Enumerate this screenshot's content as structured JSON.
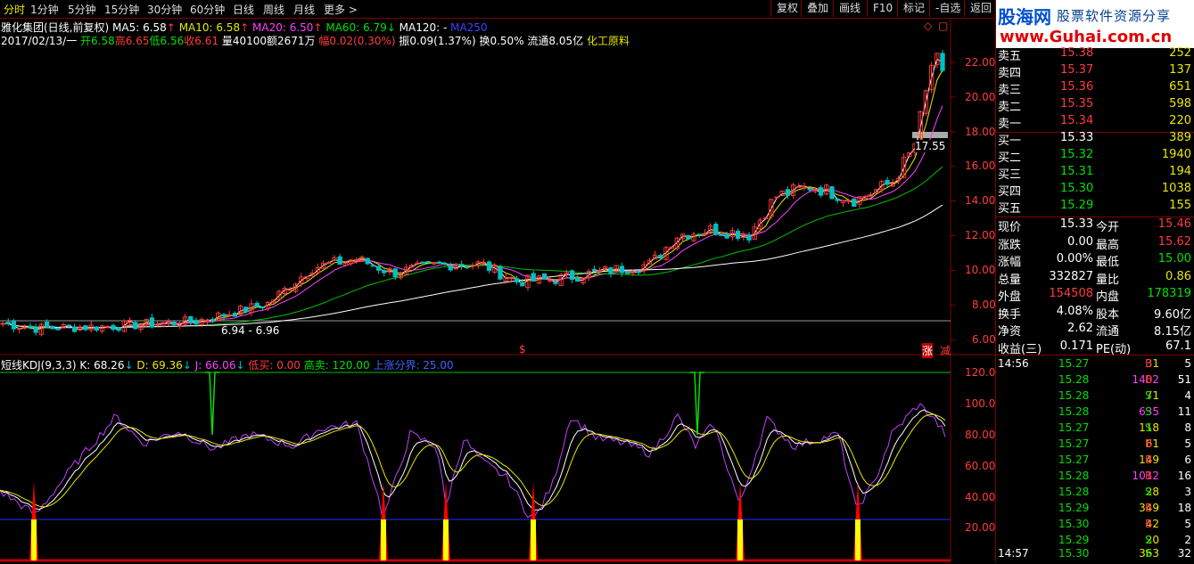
{
  "toolbar": {
    "timeframes": [
      "分时",
      "1分钟",
      "5分钟",
      "15分钟",
      "30分钟",
      "60分钟",
      "日线",
      "周线",
      "月线",
      "更多 >"
    ],
    "active_timeframe": "分时",
    "buttons": [
      "复权",
      "叠加",
      "画线",
      "F10",
      "标记",
      "-自选",
      "返回"
    ]
  },
  "header": {
    "title": "雅化集团(日线,前复权)",
    "ma5": "MA5: 6.58",
    "ma10": "MA10: 6.58",
    "ma20": "MA20: 6.50",
    "ma60": "MA60: 6.79",
    "ma120": "MA120: -",
    "ma250": "MA250",
    "date": "2017/02/13/一",
    "open": "开6.58",
    "high": "高6.65",
    "low": "低6.56",
    "close": "收6.61",
    "volume": "量40100",
    "amount": "额2671万",
    "change": "幅0.02(0.30%)",
    "amplitude": "振0.09(1.37%)",
    "turnover": "换0.50%",
    "float_cap": "流通8.05亿",
    "sector": "化工原料"
  },
  "price_axis": [
    "22.00",
    "20.00",
    "18.00",
    "16.00",
    "14.00",
    "12.00",
    "10.00",
    "8.00",
    "6.00"
  ],
  "price_annotations": {
    "low_range": "6.94 - 6.96",
    "crosshair": "17.55",
    "zhang": "涨",
    "jian": "减",
    "dollar": "$"
  },
  "kdj": {
    "name": "短线KDJ(9,3,3)",
    "k": "K: 68.26",
    "d": "D: 69.36",
    "j": "J: 66.06",
    "low_buy": "低买: 0.00",
    "high_sell": "高卖: 120.00",
    "boundary": "上涨分界: 25.00",
    "axis": [
      "120.0",
      "100.0",
      "80.00",
      "60.00",
      "40.00",
      "20.00"
    ]
  },
  "logo": {
    "brand": "股海网",
    "slogan": "股票软件资源分享",
    "url": "www.Guhai.com.cn"
  },
  "order_book": {
    "asks": [
      {
        "label": "卖五",
        "price": "15.38",
        "vol": "252"
      },
      {
        "label": "卖四",
        "price": "15.37",
        "vol": "137"
      },
      {
        "label": "卖三",
        "price": "15.36",
        "vol": "651"
      },
      {
        "label": "卖二",
        "price": "15.35",
        "vol": "598"
      },
      {
        "label": "卖一",
        "price": "15.34",
        "vol": "220"
      }
    ],
    "bids": [
      {
        "label": "买一",
        "price": "15.33",
        "vol": "389"
      },
      {
        "label": "买二",
        "price": "15.32",
        "vol": "1940"
      },
      {
        "label": "买三",
        "price": "15.31",
        "vol": "194"
      },
      {
        "label": "买四",
        "price": "15.30",
        "vol": "1038"
      },
      {
        "label": "买五",
        "price": "15.29",
        "vol": "155"
      }
    ]
  },
  "quote": [
    {
      "l1": "现价",
      "v1": "15.33",
      "l2": "今开",
      "v2": "15.46"
    },
    {
      "l1": "涨跌",
      "v1": "0.00",
      "l2": "最高",
      "v2": "15.62"
    },
    {
      "l1": "涨幅",
      "v1": "0.00%",
      "l2": "最低",
      "v2": "15.00"
    },
    {
      "l1": "总量",
      "v1": "332827",
      "l2": "量比",
      "v2": "0.86"
    },
    {
      "l1": "外盘",
      "v1": "154508",
      "l2": "内盘",
      "v2": "178319"
    },
    {
      "l1": "换手",
      "v1": "4.08%",
      "l2": "股本",
      "v2": "9.60亿"
    },
    {
      "l1": "净资",
      "v1": "2.62",
      "l2": "流通",
      "v2": "8.15亿"
    },
    {
      "l1": "收益(三)",
      "v1": "0.171",
      "l2": "PE(动)",
      "v2": "67.1"
    }
  ],
  "ticks": [
    {
      "time": "14:56",
      "price": "15.27",
      "vol": "31",
      "side": "B",
      "n": "5"
    },
    {
      "time": "",
      "price": "15.28",
      "vol": "1402",
      "side": "B",
      "n": "51"
    },
    {
      "time": "",
      "price": "15.28",
      "vol": "71",
      "side": "S",
      "n": "4"
    },
    {
      "time": "",
      "price": "15.28",
      "vol": "635",
      "side": "S",
      "n": "11"
    },
    {
      "time": "",
      "price": "15.27",
      "vol": "118",
      "side": "S",
      "n": "8"
    },
    {
      "time": "",
      "price": "15.27",
      "vol": "61",
      "side": "B",
      "n": "5"
    },
    {
      "time": "",
      "price": "15.27",
      "vol": "149",
      "side": "B",
      "n": "6"
    },
    {
      "time": "",
      "price": "15.28",
      "vol": "1012",
      "side": "B",
      "n": "16"
    },
    {
      "time": "",
      "price": "15.28",
      "vol": "28",
      "side": "S",
      "n": "3"
    },
    {
      "time": "",
      "price": "15.29",
      "vol": "349",
      "side": "B",
      "n": "18"
    },
    {
      "time": "",
      "price": "15.30",
      "vol": "42",
      "side": "B",
      "n": "5"
    },
    {
      "time": "",
      "price": "15.29",
      "vol": "20",
      "side": "S",
      "n": "2"
    },
    {
      "time": "14:57",
      "price": "15.30",
      "vol": "363",
      "side": "S",
      "n": "32"
    }
  ],
  "colors": {
    "up": "#ff3b3b",
    "down": "#00c0c0",
    "ma5": "#ffffff",
    "ma10": "#e8e800",
    "ma20": "#ff40ff",
    "ma60": "#00c000",
    "ma120": "#ffffff",
    "ma250": "#4040ff",
    "grid": "#800000"
  }
}
